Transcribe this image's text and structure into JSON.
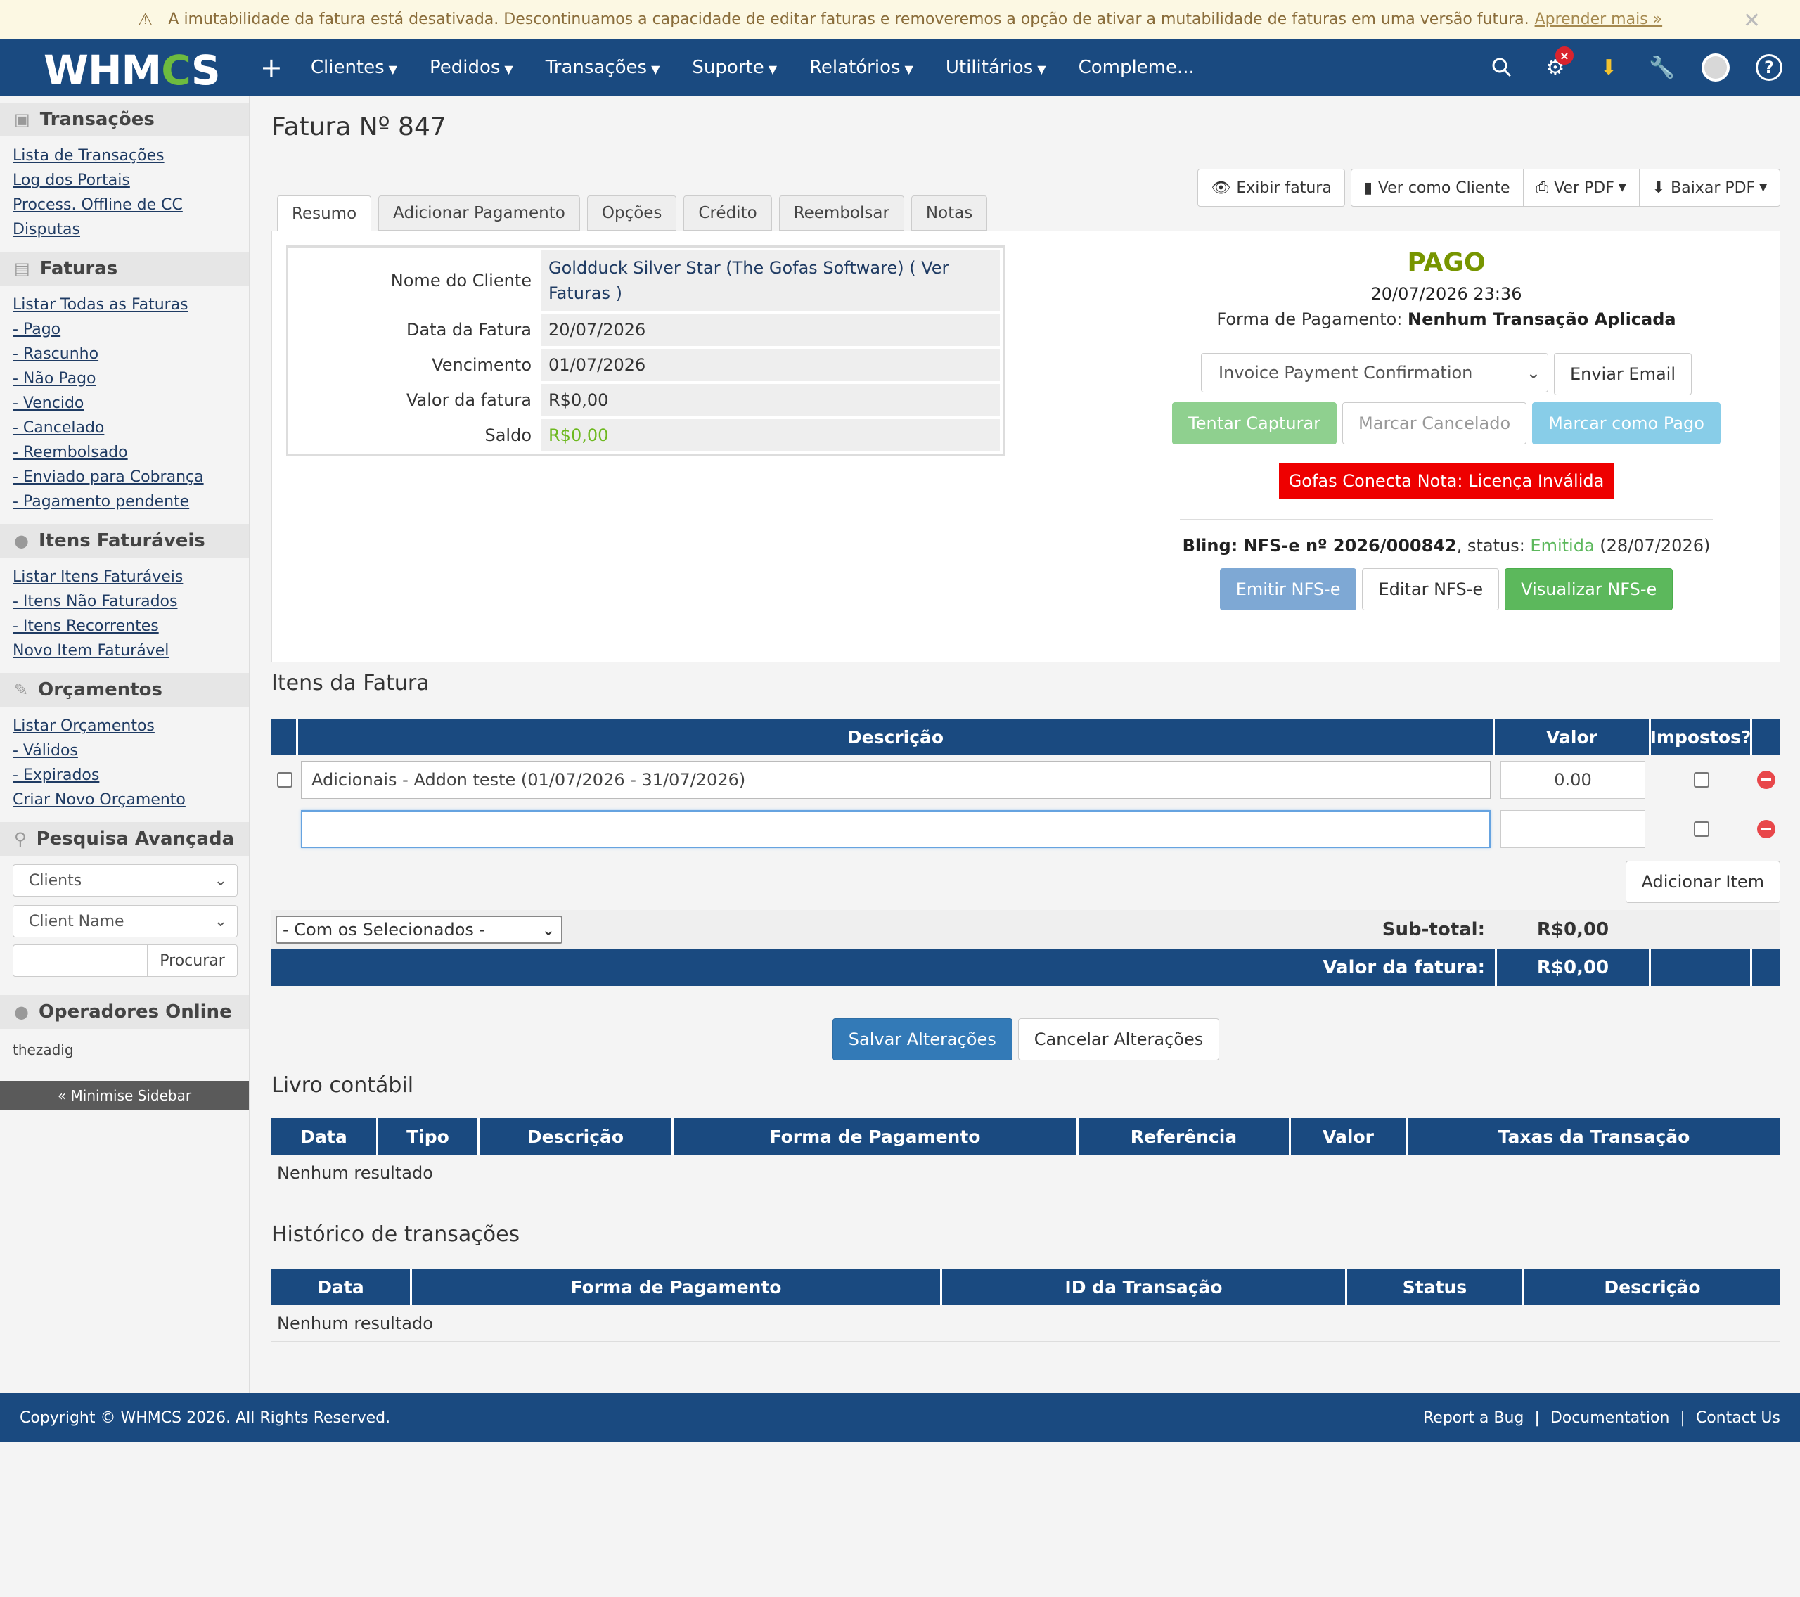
{
  "banner": {
    "text": "A imutabilidade da fatura está desativada. Descontinuamos a capacidade de editar faturas e removeremos a opção de ativar a mutabilidade de faturas em uma versão futura.",
    "link": "Aprender mais »"
  },
  "nav": {
    "logo_prefix": "WHM",
    "logo_gear": "C",
    "logo_suffix": "S",
    "items": [
      "Clientes",
      "Pedidos",
      "Transações",
      "Suporte",
      "Relatórios",
      "Utilitários",
      "Compleme..."
    ],
    "badge": "×"
  },
  "sidebar": {
    "transacoes": {
      "title": "Transações",
      "links": [
        "Lista de Transações",
        "Log dos Portais",
        "Process. Offline de CC",
        "Disputas"
      ]
    },
    "faturas": {
      "title": "Faturas",
      "links": [
        "Listar Todas as Faturas",
        "- Pago",
        "- Rascunho",
        "- Não Pago",
        "- Vencido",
        "- Cancelado",
        "- Reembolsado",
        "- Enviado para Cobrança",
        "- Pagamento pendente"
      ]
    },
    "itens": {
      "title": "Itens Faturáveis",
      "links": [
        "Listar Itens Faturáveis",
        "- Itens Não Faturados",
        "- Itens Recorrentes",
        "Novo Item Faturável"
      ]
    },
    "orcamentos": {
      "title": "Orçamentos",
      "links": [
        "Listar Orçamentos",
        "- Válidos",
        "- Expirados",
        "Criar Novo Orçamento"
      ]
    },
    "pesquisa": {
      "title": "Pesquisa Avançada",
      "select1": "Clients",
      "select2": "Client Name",
      "button": "Procurar"
    },
    "operadores": {
      "title": "Operadores Online",
      "user": "thezadig"
    },
    "minimise": "« Minimise Sidebar"
  },
  "page": {
    "title": "Fatura Nº 847",
    "top_buttons": {
      "exibir": "Exibir fatura",
      "ver_cliente": "Ver como Cliente",
      "ver_pdf": "Ver PDF",
      "baixar_pdf": "Baixar PDF"
    },
    "tabs": [
      "Resumo",
      "Adicionar Pagamento",
      "Opções",
      "Crédito",
      "Reembolsar",
      "Notas"
    ]
  },
  "summary": {
    "rows": {
      "cliente": {
        "label": "Nome do Cliente",
        "value": "Goldduck Silver Star (The Gofas Software) ( Ver Faturas )"
      },
      "data": {
        "label": "Data da Fatura",
        "value": "20/07/2026"
      },
      "vencimento": {
        "label": "Vencimento",
        "value": "01/07/2026"
      },
      "valor": {
        "label": "Valor da fatura",
        "value": "R$0,00"
      },
      "saldo": {
        "label": "Saldo",
        "value": "R$0,00"
      }
    },
    "status": "PAGO",
    "paid_date": "20/07/2026 23:36",
    "payment_method_label": "Forma de Pagamento:",
    "payment_method_value": "Nenhum Transação Aplicada",
    "email_template": "Invoice Payment Confirmation",
    "send_email": "Enviar Email",
    "tentar": "Tentar Capturar",
    "cancelado": "Marcar Cancelado",
    "pago_btn": "Marcar como Pago",
    "license": "Gofas Conecta Nota: Licença Inválida",
    "bling_prefix": "Bling: NFS-e nº 2026/000842",
    "bling_status_label": ", status:",
    "bling_status": "Emitida",
    "bling_date": "(28/07/2026)",
    "emitir": "Emitir NFS-e",
    "editar": "Editar NFS-e",
    "visualizar": "Visualizar NFS-e"
  },
  "items": {
    "title": "Itens da Fatura",
    "headers": {
      "descricao": "Descrição",
      "valor": "Valor",
      "impostos": "Impostos?"
    },
    "row1": {
      "desc": "Adicionais - Addon teste (01/07/2026 - 31/07/2026)",
      "valor": "0.00"
    },
    "add_button": "Adicionar Item",
    "with_selected": "- Com os Selecionados -",
    "subtotal_label": "Sub-total:",
    "subtotal_value": "R$0,00",
    "total_label": "Valor da fatura:",
    "total_value": "R$0,00"
  },
  "actions": {
    "save": "Salvar Alterações",
    "cancel": "Cancelar Alterações"
  },
  "ledger": {
    "title": "Livro contábil",
    "headers": [
      "Data",
      "Tipo",
      "Descrição",
      "Forma de Pagamento",
      "Referência",
      "Valor",
      "Taxas da Transação"
    ],
    "empty": "Nenhum resultado"
  },
  "history": {
    "title": "Histórico de transações",
    "headers": [
      "Data",
      "Forma de Pagamento",
      "ID da Transação",
      "Status",
      "Descrição"
    ],
    "empty": "Nenhum resultado"
  },
  "footer": {
    "copyright": "Copyright © WHMCS 2026. All Rights Reserved.",
    "report": "Report a Bug",
    "docs": "Documentation",
    "contact": "Contact Us",
    "sep": "|"
  }
}
